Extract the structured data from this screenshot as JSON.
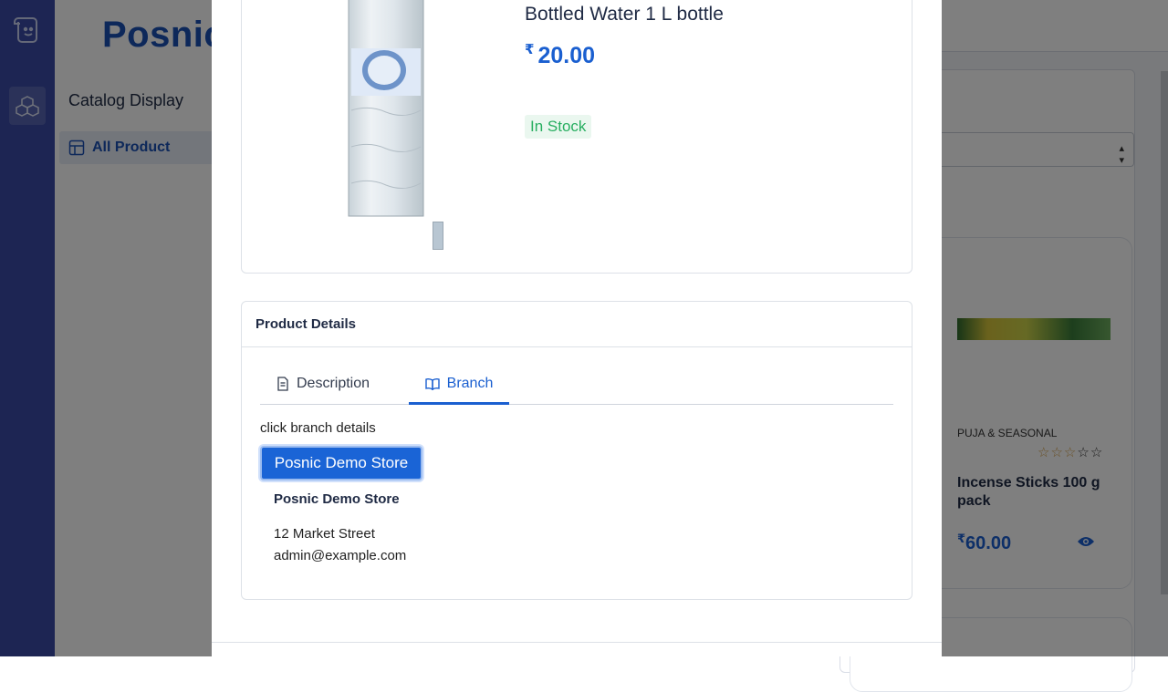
{
  "background": {
    "brand": "Posnic",
    "sidebar": {
      "title": "Catalog Display",
      "active_item": "All Product"
    },
    "product_card": {
      "category": "PUJA & SEASONAL",
      "rating": 3,
      "rating_max": 5,
      "name": "Incense Sticks 100 g pack",
      "currency": "₹",
      "price": "60.00"
    }
  },
  "modal": {
    "product": {
      "title": "Bottled Water 1 L bottle",
      "currency": "₹",
      "price": "20.00",
      "stock_status": "In Stock"
    },
    "details": {
      "header": "Product Details",
      "tabs": [
        {
          "label": "Description",
          "icon": "document-icon",
          "active": false
        },
        {
          "label": "Branch",
          "icon": "book-icon",
          "active": true
        }
      ],
      "hint": "click branch details",
      "branch_button": "Posnic Demo Store",
      "branch": {
        "name": "Posnic Demo Store",
        "address": "12 Market Street",
        "email": "admin@example.com"
      }
    }
  },
  "colors": {
    "accent": "#1a5fd0",
    "rail": "#3a4ba6",
    "stock_green": "#27ae60"
  }
}
